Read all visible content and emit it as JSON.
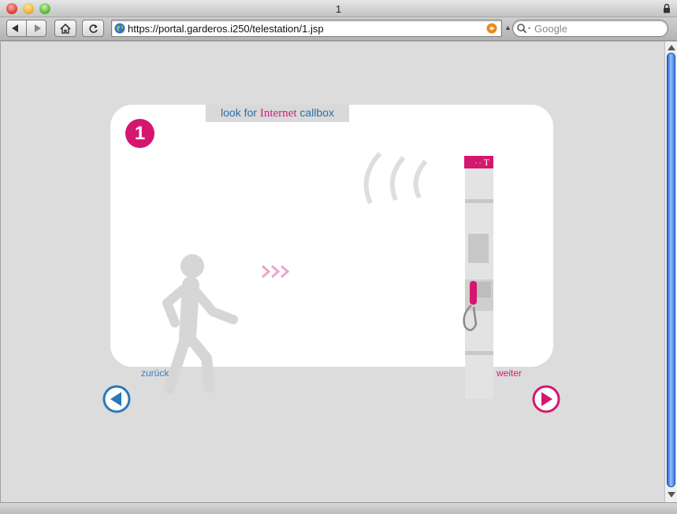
{
  "window": {
    "title": "1"
  },
  "toolbar": {
    "url": "https://portal.garderos.i250/telestation/1.jsp",
    "search_placeholder": "Google"
  },
  "page": {
    "headline_pre": "look for ",
    "headline_em": "Internet",
    "headline_post": " callbox",
    "step_number": "1",
    "back_label": "zurück",
    "next_label": "weiter",
    "brand_mark": "T",
    "brand_dots": "· ·"
  },
  "colors": {
    "brand_magenta": "#d5166f",
    "link_blue": "#2a6ea8",
    "figure_gray": "#d6d6d6"
  }
}
